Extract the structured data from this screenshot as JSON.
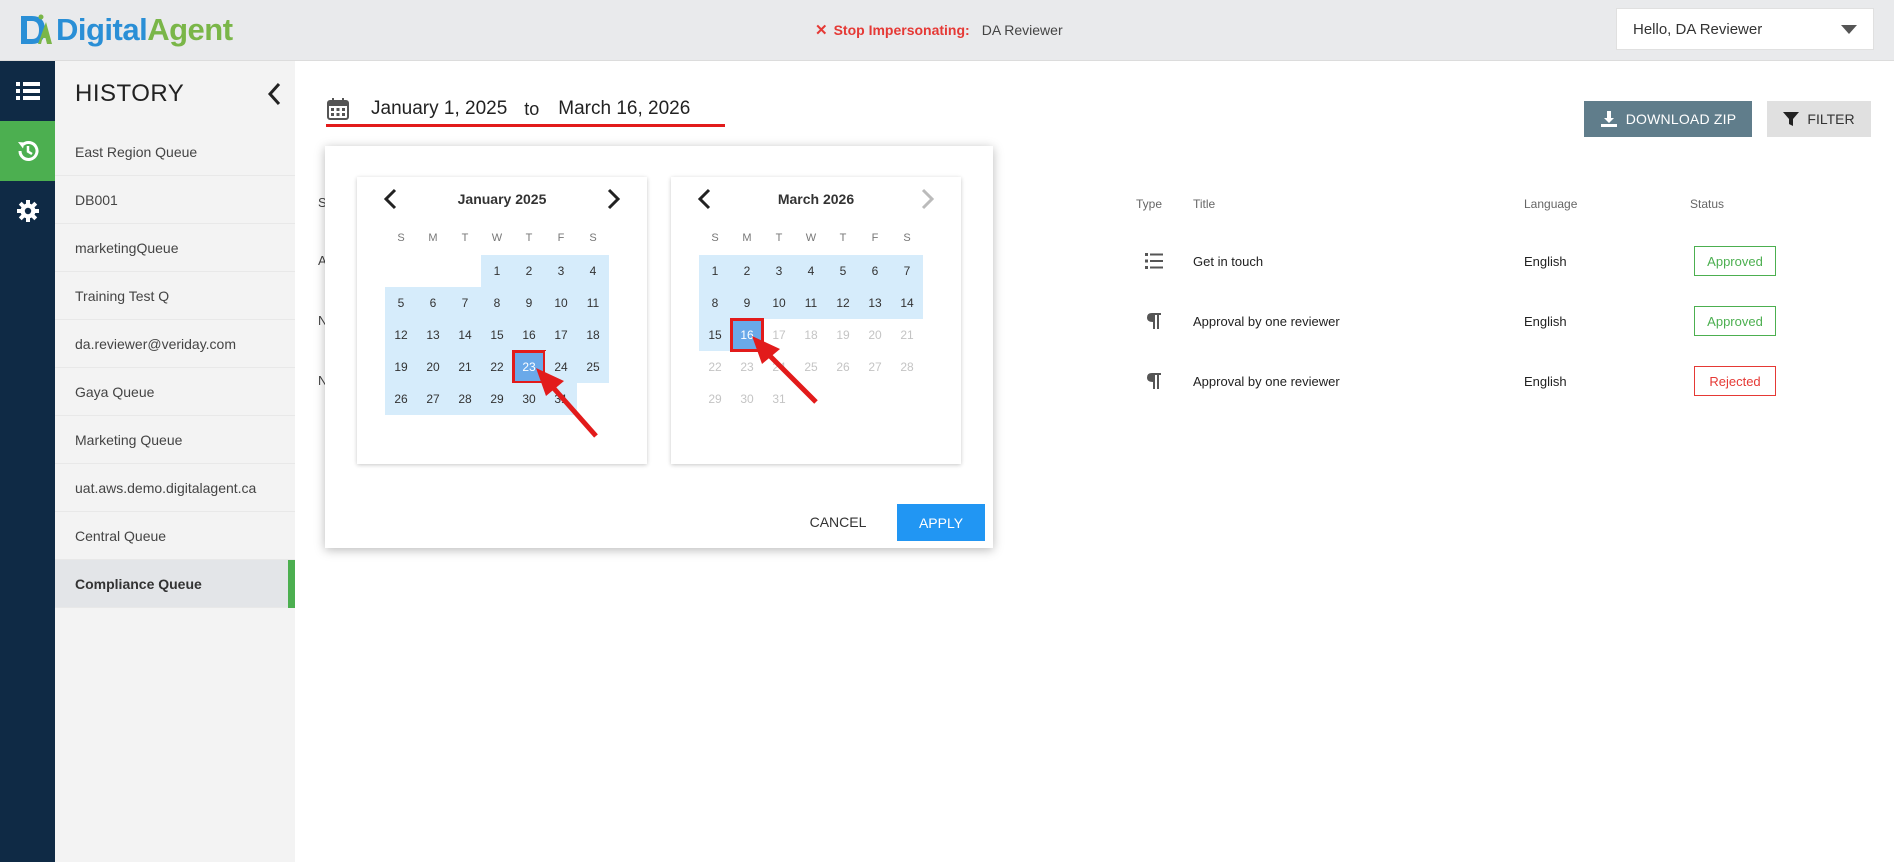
{
  "header": {
    "logo_text_a": "Digital",
    "logo_text_b": "Agent",
    "stop_label": "Stop Impersonating:",
    "impersonated_user": "DA Reviewer",
    "user_greeting": "Hello,  DA Reviewer"
  },
  "sidebar": {
    "title": "HISTORY",
    "items": [
      {
        "label": "East Region Queue"
      },
      {
        "label": "DB001"
      },
      {
        "label": "marketingQueue"
      },
      {
        "label": "Training Test Q"
      },
      {
        "label": "da.reviewer@veriday.com"
      },
      {
        "label": "Gaya Queue"
      },
      {
        "label": "Marketing Queue"
      },
      {
        "label": "uat.aws.demo.digitalagent.ca"
      },
      {
        "label": "Central Queue"
      },
      {
        "label": "Compliance Queue"
      }
    ],
    "selected_index": 9
  },
  "date_range": {
    "start": "January 1, 2025",
    "separator": "to",
    "end": "March 16, 2026"
  },
  "actions": {
    "download_label": "DOWNLOAD ZIP",
    "filter_label": "FILTER"
  },
  "table": {
    "headers": {
      "type": "Type",
      "title": "Title",
      "language": "Language",
      "status": "Status"
    },
    "rows": [
      {
        "type_icon": "list-icon",
        "title": "Get in touch",
        "language": "English",
        "status": "Approved"
      },
      {
        "type_icon": "paragraph-icon",
        "title": "Approval by one reviewer",
        "language": "English",
        "status": "Approved"
      },
      {
        "type_icon": "paragraph-icon",
        "title": "Approval by one reviewer",
        "language": "English",
        "status": "Rejected"
      }
    ],
    "partial_left_text": [
      "S",
      "A",
      "N",
      "N"
    ]
  },
  "picker": {
    "weekdays": [
      "S",
      "M",
      "T",
      "W",
      "T",
      "F",
      "S"
    ],
    "left_month": {
      "title": "January 2025",
      "first_weekday": 3,
      "days_in_month": 31,
      "selected_day": 23,
      "range_from": 1,
      "range_to": 31,
      "disabled_after": null
    },
    "right_month": {
      "title": "March 2026",
      "first_weekday": 0,
      "days_in_month": 31,
      "selected_day": 16,
      "range_from": 1,
      "range_to": 16,
      "disabled_after": 16
    },
    "cancel_label": "CANCEL",
    "apply_label": "APPLY"
  },
  "colors": {
    "accent_green": "#4caf50",
    "nav_dark": "#0f2a45",
    "apply_blue": "#2196f3",
    "range_blue": "#d6ecfb",
    "selected_blue": "#6aa9e9",
    "annotation_red": "#e21b1b"
  }
}
